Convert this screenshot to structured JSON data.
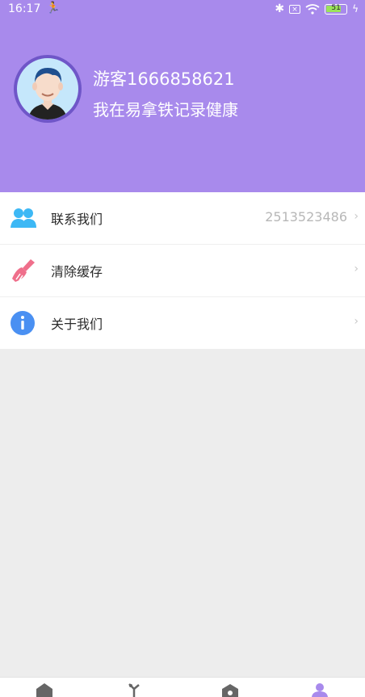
{
  "status_bar": {
    "time": "16:17",
    "battery_level": "51",
    "icons": [
      "runner-icon",
      "bluetooth-icon",
      "sim-off-icon",
      "wifi-icon",
      "battery-icon",
      "charging-icon"
    ]
  },
  "profile": {
    "name": "游客1666858621",
    "tagline": "我在易拿铁记录健康"
  },
  "menu": {
    "items": [
      {
        "label": "联系我们",
        "value": "2513523486",
        "icon": "contacts-icon",
        "icon_color": "#3db8f5"
      },
      {
        "label": "清除缓存",
        "value": "",
        "icon": "broom-icon",
        "icon_color": "#ef6f8b"
      },
      {
        "label": "关于我们",
        "value": "",
        "icon": "info-icon",
        "icon_color": "#4a90f2"
      }
    ]
  },
  "tab_bar": {
    "tabs": [
      {
        "icon": "home-icon",
        "active": false
      },
      {
        "icon": "discover-icon",
        "active": false
      },
      {
        "icon": "camera-icon",
        "active": false
      },
      {
        "icon": "profile-icon",
        "active": true
      }
    ],
    "active_color": "#a88aec"
  },
  "colors": {
    "header": "#a88aec",
    "background": "#ededed"
  }
}
